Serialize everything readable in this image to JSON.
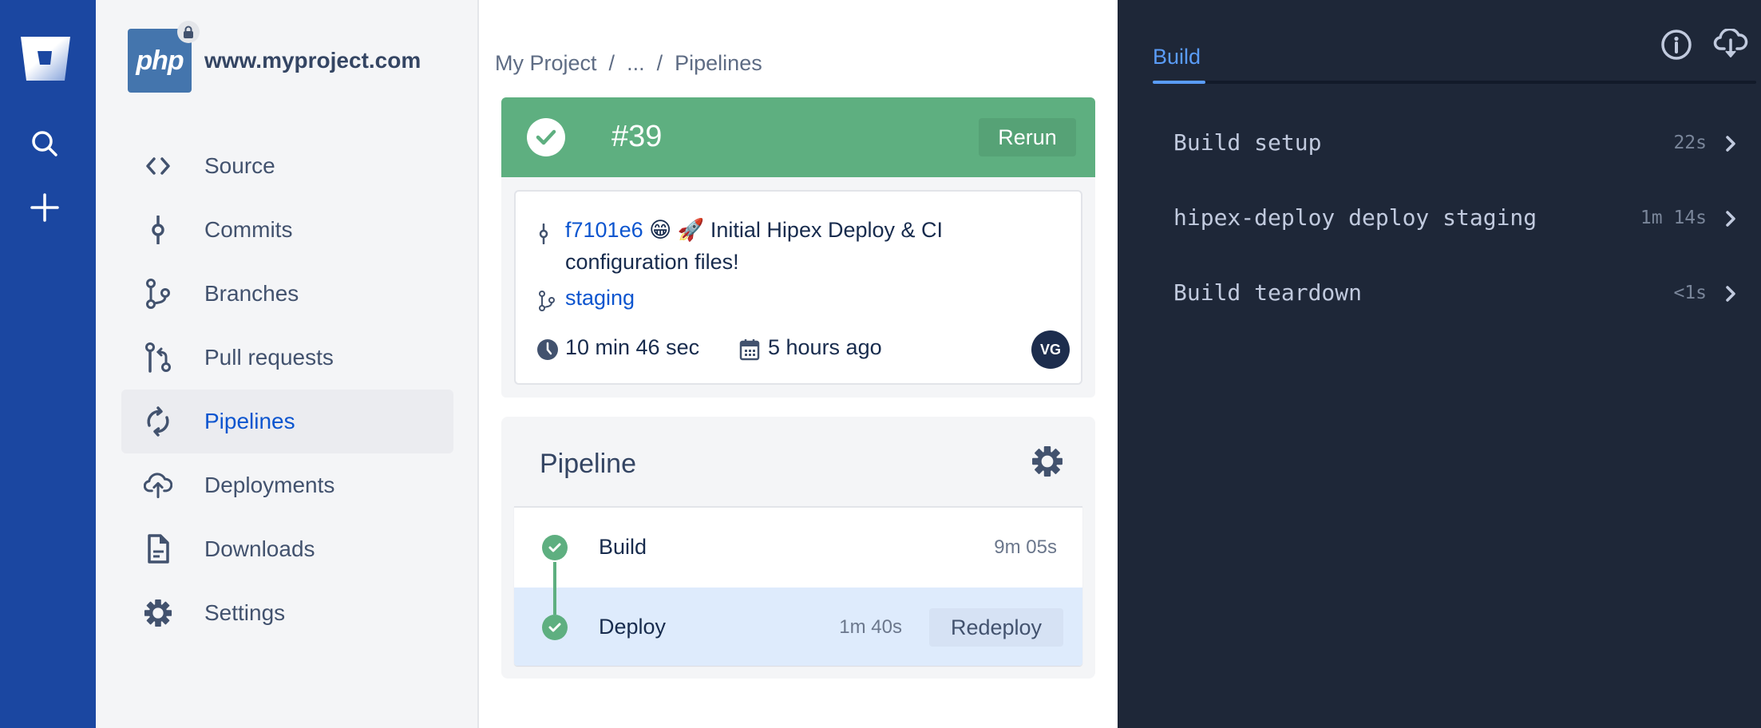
{
  "global_nav": {
    "logo_icon": "bitbucket-logo-icon",
    "search_icon": "search-icon",
    "create_icon": "plus-icon"
  },
  "sidebar": {
    "project_avatar_text": "php",
    "project_name": "www.myproject.com",
    "items": [
      {
        "label": "Source",
        "icon": "code-icon"
      },
      {
        "label": "Commits",
        "icon": "commit-icon"
      },
      {
        "label": "Branches",
        "icon": "branch-icon"
      },
      {
        "label": "Pull requests",
        "icon": "pull-request-icon"
      },
      {
        "label": "Pipelines",
        "icon": "pipelines-icon",
        "active": true
      },
      {
        "label": "Deployments",
        "icon": "cloud-upload-icon"
      },
      {
        "label": "Downloads",
        "icon": "file-icon"
      },
      {
        "label": "Settings",
        "icon": "gear-icon"
      }
    ]
  },
  "breadcrumb": {
    "items": [
      "My Project",
      "...",
      "Pipelines"
    ],
    "separator": "/"
  },
  "pipeline_run": {
    "number": "#39",
    "status": "successful",
    "status_color": "#5eaf80",
    "rerun_label": "Rerun",
    "commit": {
      "hash": "f7101e6",
      "message": "😁 🚀 Initial Hipex Deploy & CI configuration files!",
      "branch": "staging",
      "duration": "10 min 46 sec",
      "started": "5 hours ago",
      "author_initials": "VG"
    }
  },
  "pipeline": {
    "title": "Pipeline",
    "steps": [
      {
        "name": "Build",
        "duration": "9m 05s",
        "status": "success"
      },
      {
        "name": "Deploy",
        "duration": "1m 40s",
        "status": "success",
        "action": "Redeploy",
        "selected": true
      }
    ]
  },
  "log_panel": {
    "tab": "Build",
    "info_icon": "info-icon",
    "download_icon": "cloud-download-icon",
    "rows": [
      {
        "name": "Build setup",
        "duration": "22s"
      },
      {
        "name": "hipex-deploy deploy staging",
        "duration": "1m 14s"
      },
      {
        "name": "Build teardown",
        "duration": "<1s"
      }
    ]
  }
}
